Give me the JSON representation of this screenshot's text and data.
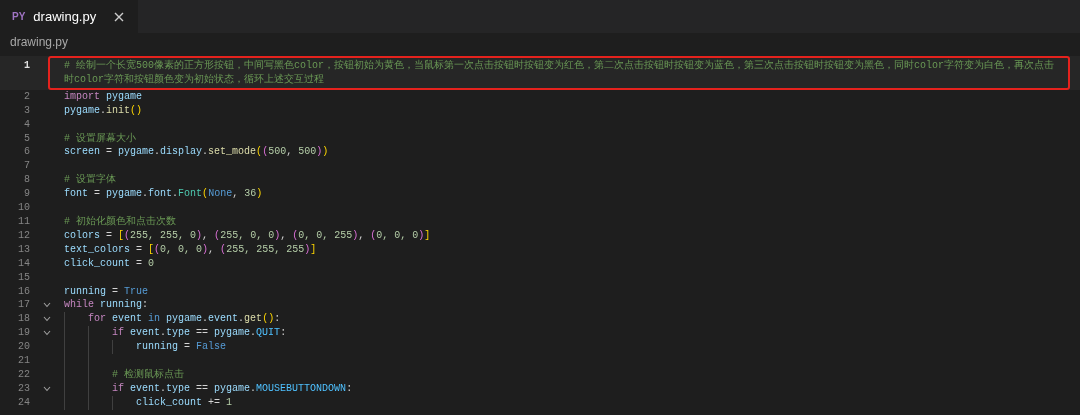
{
  "tabs": [
    {
      "icon": "PY",
      "label": "drawing.py",
      "selected": true
    }
  ],
  "breadcrumb": "drawing.py",
  "lines": [
    {
      "num": "1",
      "selected": true,
      "boxed": true,
      "tokens": [
        {
          "kind": "cmt",
          "text": "# 绘制一个长宽500像素的正方形按钮，中间写黑色color，按钮初始为黄色，当鼠标第一次点击按钮时按钮变为红色，第二次点击按钮时按钮变为蓝色，第三次点击按钮时按钮变为黑色，同时color字符变为白色，再次点击时color字符和按钮颜色变为初始状态，循环上述交互过程"
        }
      ]
    },
    {
      "num": "2",
      "selected": false,
      "boxed": false,
      "tokens": [
        {
          "kind": "ctrl",
          "text": "import "
        },
        {
          "kind": "var",
          "text": "pygame"
        }
      ]
    },
    {
      "num": "3",
      "selected": false,
      "boxed": false,
      "tokens": [
        {
          "kind": "var",
          "text": "pygame"
        },
        {
          "kind": "op",
          "text": "."
        },
        {
          "kind": "fn",
          "text": "init"
        },
        {
          "kind": "br1",
          "text": "()"
        }
      ]
    },
    {
      "num": "4",
      "selected": false,
      "boxed": false
    },
    {
      "num": "5",
      "selected": false,
      "boxed": false,
      "tokens": [
        {
          "kind": "cmt",
          "text": "# 设置屏幕大小"
        }
      ]
    },
    {
      "num": "6",
      "selected": false,
      "boxed": false,
      "tokens": [
        {
          "kind": "var",
          "text": "screen"
        },
        {
          "kind": "op",
          "text": " = "
        },
        {
          "kind": "var",
          "text": "pygame"
        },
        {
          "kind": "op",
          "text": "."
        },
        {
          "kind": "var",
          "text": "display"
        },
        {
          "kind": "op",
          "text": "."
        },
        {
          "kind": "fn",
          "text": "set_mode"
        },
        {
          "kind": "br1",
          "text": "("
        },
        {
          "kind": "br2",
          "text": "("
        },
        {
          "kind": "num",
          "text": "500"
        },
        {
          "kind": "op",
          "text": ", "
        },
        {
          "kind": "num",
          "text": "500"
        },
        {
          "kind": "br2",
          "text": ")"
        },
        {
          "kind": "br1",
          "text": ")"
        }
      ]
    },
    {
      "num": "7",
      "selected": false,
      "boxed": false
    },
    {
      "num": "8",
      "selected": false,
      "boxed": false,
      "tokens": [
        {
          "kind": "cmt",
          "text": "# 设置字体"
        }
      ]
    },
    {
      "num": "9",
      "selected": false,
      "boxed": false,
      "tokens": [
        {
          "kind": "var",
          "text": "font"
        },
        {
          "kind": "op",
          "text": " = "
        },
        {
          "kind": "var",
          "text": "pygame"
        },
        {
          "kind": "op",
          "text": "."
        },
        {
          "kind": "var",
          "text": "font"
        },
        {
          "kind": "op",
          "text": "."
        },
        {
          "kind": "cls",
          "text": "Font"
        },
        {
          "kind": "br1",
          "text": "("
        },
        {
          "kind": "const",
          "text": "None"
        },
        {
          "kind": "op",
          "text": ", "
        },
        {
          "kind": "num",
          "text": "36"
        },
        {
          "kind": "br1",
          "text": ")"
        }
      ]
    },
    {
      "num": "10",
      "selected": false,
      "boxed": false
    },
    {
      "num": "11",
      "selected": false,
      "boxed": false,
      "tokens": [
        {
          "kind": "cmt",
          "text": "# 初始化颜色和点击次数"
        }
      ]
    },
    {
      "num": "12",
      "selected": false,
      "boxed": false,
      "tokens": [
        {
          "kind": "var",
          "text": "colors"
        },
        {
          "kind": "op",
          "text": " = "
        },
        {
          "kind": "br1",
          "text": "["
        },
        {
          "kind": "br2",
          "text": "("
        },
        {
          "kind": "num",
          "text": "255, 255, 0"
        },
        {
          "kind": "br2",
          "text": ")"
        },
        {
          "kind": "op",
          "text": ", "
        },
        {
          "kind": "br2",
          "text": "("
        },
        {
          "kind": "num",
          "text": "255, 0, 0"
        },
        {
          "kind": "br2",
          "text": ")"
        },
        {
          "kind": "op",
          "text": ", "
        },
        {
          "kind": "br2",
          "text": "("
        },
        {
          "kind": "num",
          "text": "0, 0, 255"
        },
        {
          "kind": "br2",
          "text": ")"
        },
        {
          "kind": "op",
          "text": ", "
        },
        {
          "kind": "br2",
          "text": "("
        },
        {
          "kind": "num",
          "text": "0, 0, 0"
        },
        {
          "kind": "br2",
          "text": ")"
        },
        {
          "kind": "br1",
          "text": "]"
        }
      ]
    },
    {
      "num": "13",
      "selected": false,
      "boxed": false,
      "tokens": [
        {
          "kind": "var",
          "text": "text_colors"
        },
        {
          "kind": "op",
          "text": " = "
        },
        {
          "kind": "br1",
          "text": "["
        },
        {
          "kind": "br2",
          "text": "("
        },
        {
          "kind": "num",
          "text": "0, 0, 0"
        },
        {
          "kind": "br2",
          "text": ")"
        },
        {
          "kind": "op",
          "text": ", "
        },
        {
          "kind": "br2",
          "text": "("
        },
        {
          "kind": "num",
          "text": "255, 255, 255"
        },
        {
          "kind": "br2",
          "text": ")"
        },
        {
          "kind": "br1",
          "text": "]"
        }
      ]
    },
    {
      "num": "14",
      "selected": false,
      "boxed": false,
      "tokens": [
        {
          "kind": "var",
          "text": "click_count"
        },
        {
          "kind": "op",
          "text": " = "
        },
        {
          "kind": "num",
          "text": "0"
        }
      ]
    },
    {
      "num": "15",
      "selected": false,
      "boxed": false
    },
    {
      "num": "16",
      "selected": false,
      "boxed": false,
      "tokens": [
        {
          "kind": "var",
          "text": "running"
        },
        {
          "kind": "op",
          "text": " = "
        },
        {
          "kind": "const",
          "text": "True"
        }
      ]
    },
    {
      "num": "17",
      "selected": false,
      "boxed": false,
      "expanded": true,
      "tokens": [
        {
          "kind": "ctrl",
          "text": "while "
        },
        {
          "kind": "var",
          "text": "running"
        },
        {
          "kind": "op",
          "text": ":"
        }
      ],
      "children": [
        {
          "num": "18",
          "selected": false,
          "boxed": false,
          "expanded": true,
          "tokens": [
            {
              "kind": "ctrl",
              "text": "for "
            },
            {
              "kind": "var",
              "text": "event "
            },
            {
              "kind": "const",
              "text": "in "
            },
            {
              "kind": "var",
              "text": "pygame"
            },
            {
              "kind": "op",
              "text": "."
            },
            {
              "kind": "var",
              "text": "event"
            },
            {
              "kind": "op",
              "text": "."
            },
            {
              "kind": "fn",
              "text": "get"
            },
            {
              "kind": "br1",
              "text": "()"
            },
            {
              "kind": "op",
              "text": ":"
            }
          ],
          "children": [
            {
              "num": "19",
              "selected": false,
              "boxed": false,
              "expanded": true,
              "tokens": [
                {
                  "kind": "ctrl",
                  "text": "if "
                },
                {
                  "kind": "var",
                  "text": "event"
                },
                {
                  "kind": "op",
                  "text": "."
                },
                {
                  "kind": "var",
                  "text": "type"
                },
                {
                  "kind": "op",
                  "text": " == "
                },
                {
                  "kind": "var",
                  "text": "pygame"
                },
                {
                  "kind": "op",
                  "text": "."
                },
                {
                  "kind": "cst",
                  "text": "QUIT"
                },
                {
                  "kind": "op",
                  "text": ":"
                }
              ],
              "children": [
                {
                  "num": "20",
                  "selected": false,
                  "boxed": false,
                  "tokens": [
                    {
                      "kind": "var",
                      "text": "running"
                    },
                    {
                      "kind": "op",
                      "text": " = "
                    },
                    {
                      "kind": "const",
                      "text": "False"
                    }
                  ]
                }
              ]
            },
            {
              "num": "21",
              "selected": false,
              "boxed": false
            },
            {
              "num": "22",
              "selected": false,
              "boxed": false,
              "tokens": [
                {
                  "kind": "cmt",
                  "text": "# 检测鼠标点击"
                }
              ]
            },
            {
              "num": "23",
              "selected": false,
              "boxed": false,
              "expanded": true,
              "tokens": [
                {
                  "kind": "ctrl",
                  "text": "if "
                },
                {
                  "kind": "var",
                  "text": "event"
                },
                {
                  "kind": "op",
                  "text": "."
                },
                {
                  "kind": "var",
                  "text": "type"
                },
                {
                  "kind": "op",
                  "text": " == "
                },
                {
                  "kind": "var",
                  "text": "pygame"
                },
                {
                  "kind": "op",
                  "text": "."
                },
                {
                  "kind": "cst",
                  "text": "MOUSEBUTTONDOWN"
                },
                {
                  "kind": "op",
                  "text": ":"
                }
              ],
              "children": [
                {
                  "num": "24",
                  "selected": false,
                  "boxed": false,
                  "tokens": [
                    {
                      "kind": "var",
                      "text": "click_count"
                    },
                    {
                      "kind": "op",
                      "text": " += "
                    },
                    {
                      "kind": "num",
                      "text": "1"
                    }
                  ]
                }
              ]
            }
          ]
        }
      ]
    }
  ]
}
